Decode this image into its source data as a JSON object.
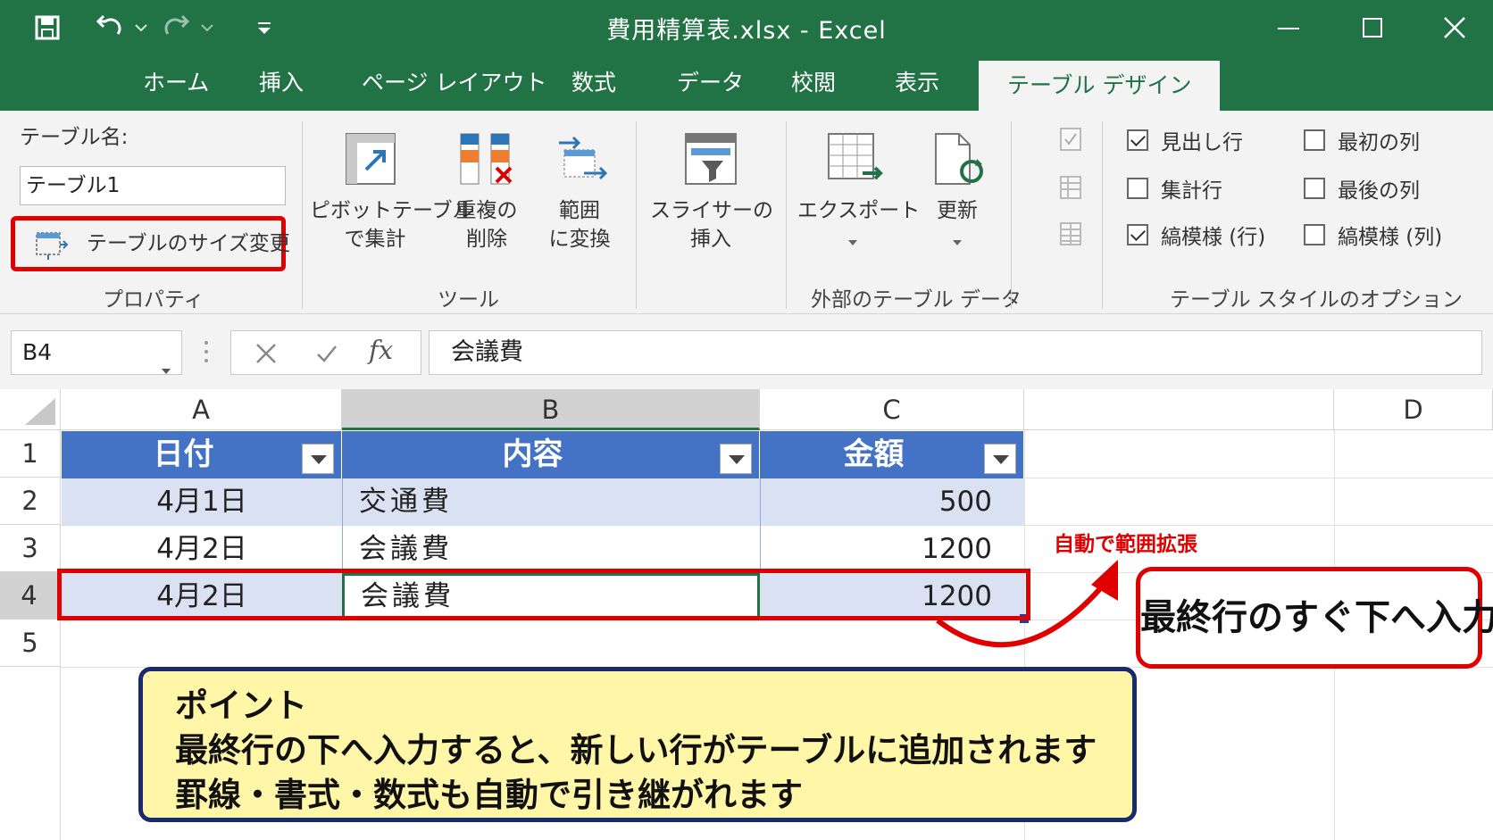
{
  "window": {
    "title": "費用精算表.xlsx  -  Excel"
  },
  "tabs": [
    "ホーム",
    "挿入",
    "ページ レイアウト",
    "数式",
    "データ",
    "校閲",
    "表示",
    "テーブル デザイン"
  ],
  "ribbon": {
    "properties": {
      "name_label": "テーブル名:",
      "name_value": "テーブル1",
      "resize_label": "テーブルのサイズ変更",
      "group_label": "プロパティ"
    },
    "tools": {
      "pivot_line1": "ピボットテーブル",
      "pivot_line2": "で集計",
      "dup_line1": "重複の",
      "dup_line2": "削除",
      "conv_line1": "範囲",
      "conv_line2": "に変換",
      "slicer_line1": "スライサーの",
      "slicer_line2": "挿入",
      "group_label": "ツール"
    },
    "external": {
      "export_label": "エクスポート",
      "refresh_label": "更新",
      "group_label": "外部のテーブル データ"
    },
    "style_options": {
      "header_row": "見出し行",
      "total_row": "集計行",
      "banded_rows": "縞模様 (行)",
      "first_column": "最初の列",
      "last_column": "最後の列",
      "banded_columns": "縞模様 (列)",
      "group_label": "テーブル スタイルのオプション"
    }
  },
  "formula_bar": {
    "name_box": "B4",
    "formula": "会議費",
    "fx": "fx"
  },
  "sheet": {
    "columns": [
      "A",
      "B",
      "C",
      "D"
    ],
    "rows": [
      "1",
      "2",
      "3",
      "4",
      "5"
    ],
    "headers": [
      "日付",
      "内容",
      "金額"
    ],
    "data": [
      [
        "4月1日",
        "交通費",
        "500"
      ],
      [
        "4月2日",
        "会議費",
        "1200"
      ],
      [
        "4月2日",
        "会議費",
        "1200"
      ]
    ]
  },
  "annotations": {
    "auto_expand": "自動で範囲拡張",
    "callout": "最終行のすぐ下へ入力",
    "point_title": "ポイント",
    "point_line1": "最終行の下へ入力すると、新しい行がテーブルに追加されます",
    "point_line2": "罫線・書式・数式も自動で引き継がれます"
  }
}
